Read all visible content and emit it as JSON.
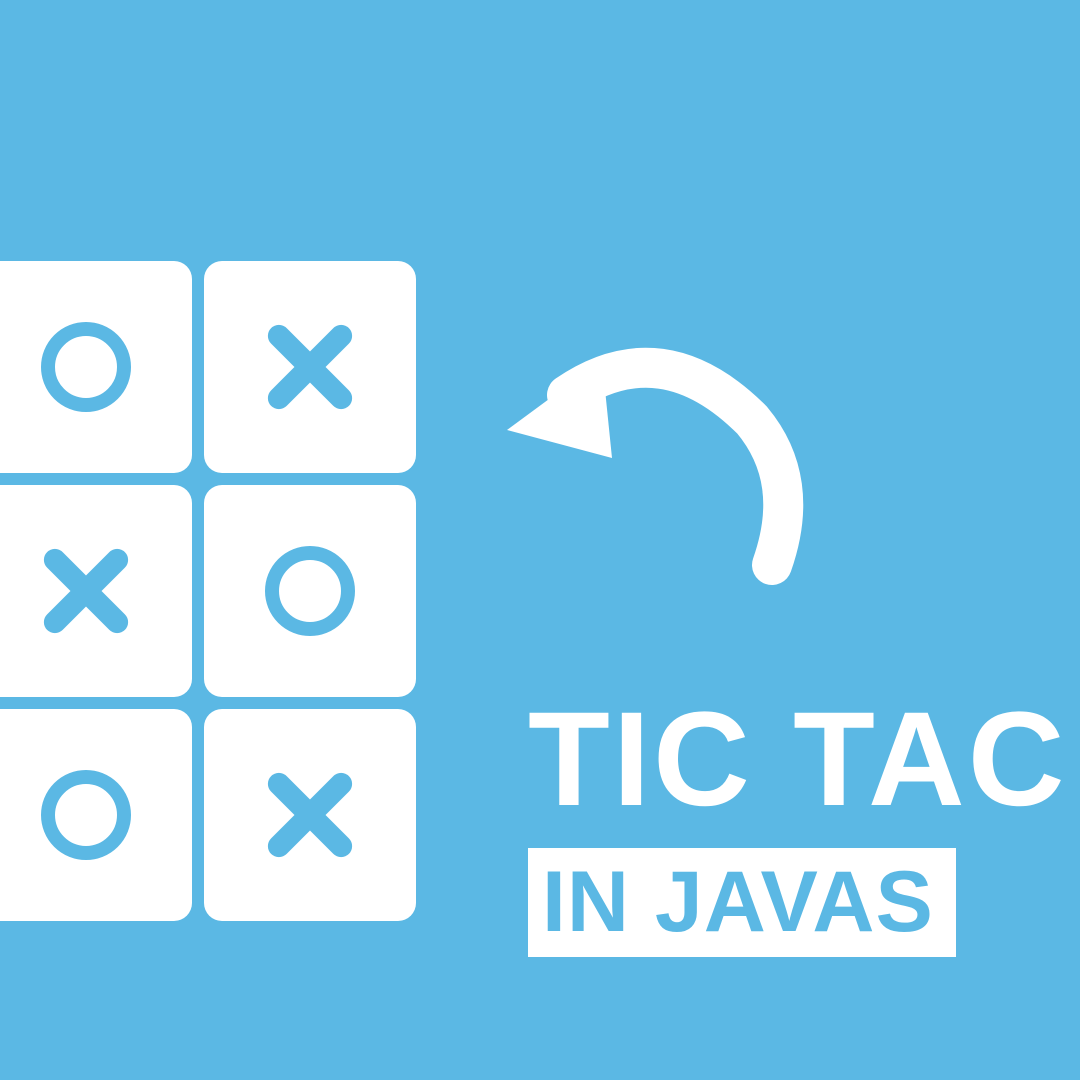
{
  "colors": {
    "background": "#5bb8e4",
    "foreground": "#ffffff"
  },
  "title": "TIC TAC",
  "subtitle": "IN JAVAS",
  "board": {
    "cells": [
      "O",
      "X",
      "X",
      "O",
      "O",
      "X"
    ]
  }
}
